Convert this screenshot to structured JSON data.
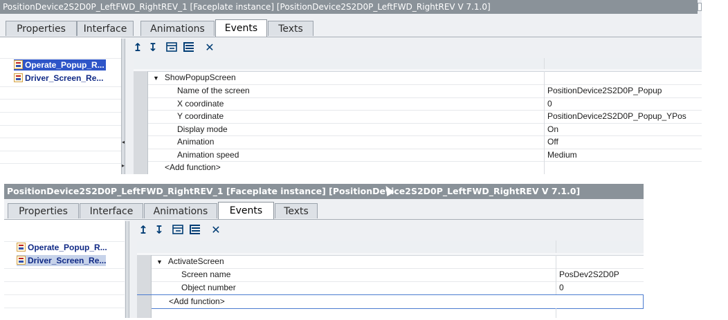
{
  "window1": {
    "title": "PositionDevice2S2D0P_LeftFWD_RightREV_1 [Faceplate instance] [PositionDevice2S2D0P_LeftFWD_RightREV V 7.1.0]",
    "tabs": [
      "Properties",
      "Interface",
      "Animations",
      "Events",
      "Texts"
    ],
    "active_tab": "Events",
    "left_items": [
      "Operate_Popup_R...",
      "Driver_Screen_Re..."
    ],
    "selected_item": "Operate_Popup_R...",
    "function_name": "ShowPopupScreen",
    "params": [
      {
        "name": "Name of the screen",
        "value": "PositionDevice2S2D0P_Popup"
      },
      {
        "name": "X coordinate",
        "value": "0"
      },
      {
        "name": "Y coordinate",
        "value": "PositionDevice2S2D0P_Popup_YPos"
      },
      {
        "name": "Display mode",
        "value": "On"
      },
      {
        "name": "Animation",
        "value": "Off"
      },
      {
        "name": "Animation speed",
        "value": "Medium"
      }
    ],
    "add_function": "<Add function>"
  },
  "window2": {
    "title": "PositionDevice2S2D0P_LeftFWD_RightREV_1 [Faceplate instance] [PositionDevice2S2D0P_LeftFWD_RightREV V 7.1.0]",
    "tabs": [
      "Properties",
      "Interface",
      "Animations",
      "Events",
      "Texts"
    ],
    "active_tab": "Events",
    "left_items": [
      "Operate_Popup_R...",
      "Driver_Screen_Re..."
    ],
    "selected_item": "Driver_Screen_Re...",
    "function_name": "ActivateScreen",
    "params": [
      {
        "name": "Screen name",
        "value": "PosDev2S2D0P"
      },
      {
        "name": "Object number",
        "value": "0"
      }
    ],
    "add_function": "<Add function>"
  },
  "toolbar_icons": [
    "move-up-icon",
    "move-down-icon",
    "collapse-all-icon",
    "expand-all-icon",
    "delete-icon"
  ],
  "colors": {
    "title_bg": "#8a9299",
    "selection": "#2e55c8",
    "item_text": "#102a86"
  }
}
